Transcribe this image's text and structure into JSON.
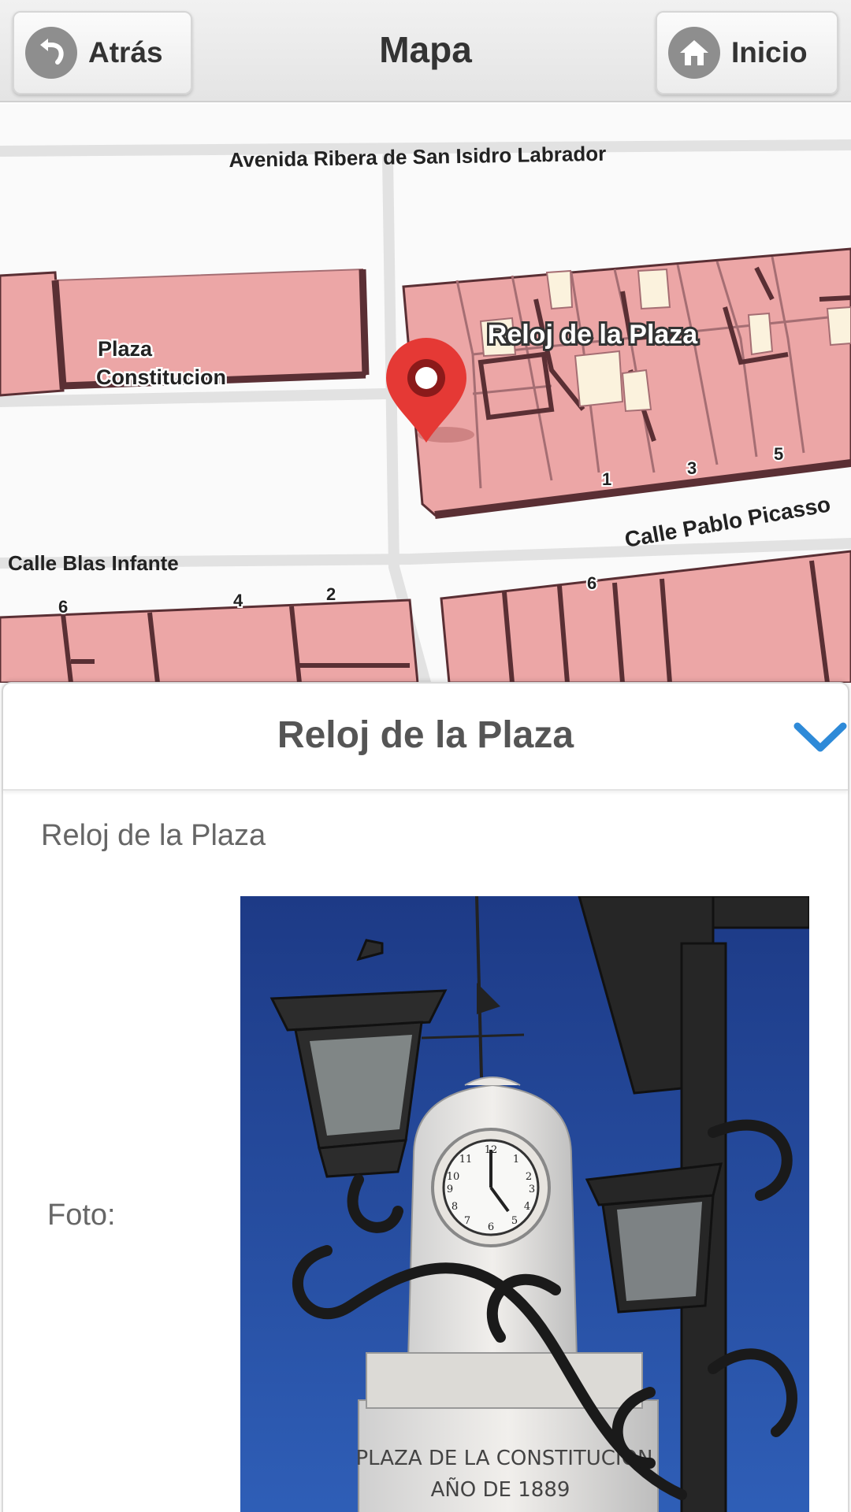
{
  "header": {
    "back_label": "Atrás",
    "title": "Mapa",
    "home_label": "Inicio"
  },
  "map": {
    "streets": {
      "avenida": "Avenida Ribera de San Isidro Labrador",
      "pablo_picasso": "Calle Pablo Picasso",
      "blas_infante": "Calle Blas Infante"
    },
    "plaza_line1": "Plaza",
    "plaza_line2": "Constitucion",
    "marker_label": "Reloj de la Plaza",
    "numbers": [
      "1",
      "3",
      "5",
      "6",
      "6",
      "4",
      "2"
    ],
    "colors": {
      "building": "#eca6a6",
      "building_edge": "#5a2f34",
      "courtyard": "#fbf2dd",
      "marker": "#e53935"
    }
  },
  "panel": {
    "title": "Reloj de la Plaza",
    "subtitle": "Reloj de la Plaza",
    "foto_label": "Foto:",
    "photo": {
      "plaque_line1": "PLAZA DE LA CONSTITUCION",
      "plaque_line2": "AÑO DE 1889"
    },
    "accent_color": "#2e8ad8"
  }
}
